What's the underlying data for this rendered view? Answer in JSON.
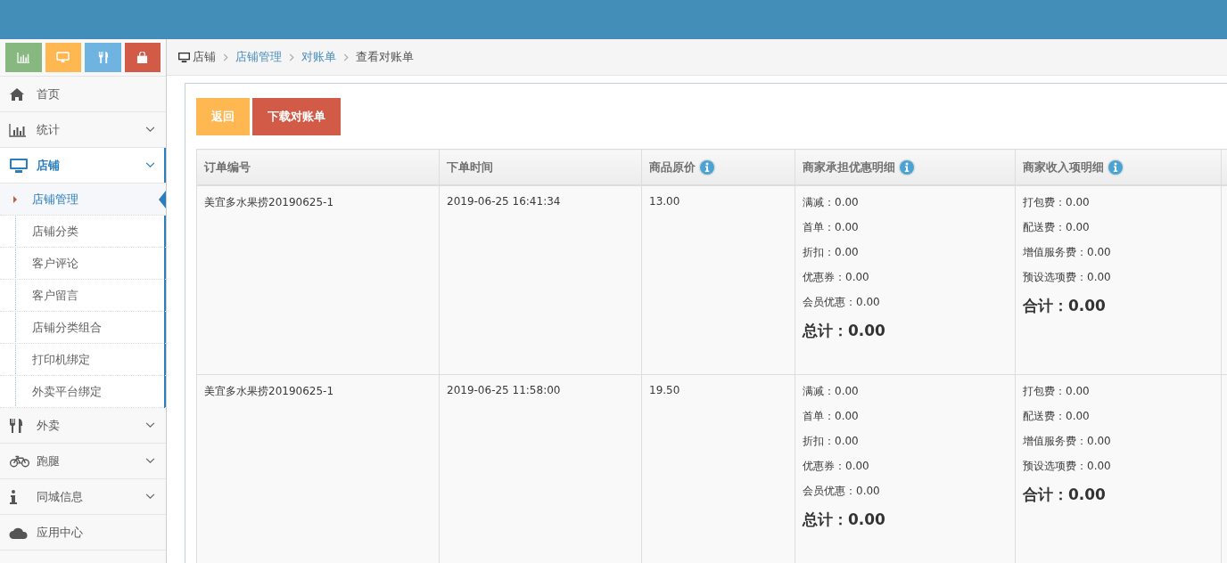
{
  "sidebar": {
    "shortcuts": [
      {
        "kind": "chart",
        "color": "#87b87f"
      },
      {
        "kind": "monitor",
        "color": "#ffb752"
      },
      {
        "kind": "utensils",
        "color": "#6fb3e0"
      },
      {
        "kind": "bag",
        "color": "#d15b47"
      }
    ],
    "menu": [
      {
        "label": "首页",
        "kind": "home",
        "has_children": false,
        "expanded": false,
        "selected": false
      },
      {
        "label": "统计",
        "kind": "chart",
        "has_children": true,
        "expanded": false,
        "selected": false
      },
      {
        "label": "店铺",
        "kind": "monitor",
        "has_children": true,
        "expanded": true,
        "selected": true,
        "children": [
          {
            "label": "店铺管理",
            "selected": true
          },
          {
            "label": "店铺分类",
            "selected": false
          },
          {
            "label": "客户评论",
            "selected": false
          },
          {
            "label": "客户留言",
            "selected": false
          },
          {
            "label": "店铺分类组合",
            "selected": false
          },
          {
            "label": "打印机绑定",
            "selected": false
          },
          {
            "label": "外卖平台绑定",
            "selected": false
          }
        ]
      },
      {
        "label": "外卖",
        "kind": "utensils",
        "has_children": true,
        "expanded": false,
        "selected": false
      },
      {
        "label": "跑腿",
        "kind": "bicycle",
        "has_children": true,
        "expanded": false,
        "selected": false
      },
      {
        "label": "同城信息",
        "kind": "info",
        "has_children": true,
        "expanded": false,
        "selected": false
      },
      {
        "label": "应用中心",
        "kind": "cloud",
        "has_children": false,
        "expanded": false,
        "selected": false
      }
    ]
  },
  "breadcrumb": [
    {
      "label": "店铺",
      "kind": "home"
    },
    {
      "label": "店铺管理",
      "kind": "link"
    },
    {
      "label": "对账单",
      "kind": "link"
    },
    {
      "label": "查看对账单",
      "kind": "current"
    }
  ],
  "buttons": [
    {
      "label": "返回",
      "color": "#ffb752"
    },
    {
      "label": "下载对账单",
      "color": "#d15b47"
    }
  ],
  "table": {
    "columns": [
      {
        "label": "订单编号",
        "info": false
      },
      {
        "label": "下单时间",
        "info": false
      },
      {
        "label": "商品原价",
        "info": true
      },
      {
        "label": "商家承担优惠明细",
        "info": true
      },
      {
        "label": "商家收入项明细",
        "info": true
      }
    ],
    "rows": [
      {
        "order_no": "美宜多水果捞20190625-1",
        "time": "2019-06-25 16:41:34",
        "price": "13.00",
        "discounts": [
          "满减：0.00",
          "首单：0.00",
          "折扣：0.00",
          "优惠券：0.00",
          "会员优惠：0.00"
        ],
        "discount_total": "总计：0.00",
        "income": [
          "打包费：0.00",
          "配送费：0.00",
          "增值服务费：0.00",
          "预设选项费：0.00"
        ],
        "income_total": "合计：0.00"
      },
      {
        "order_no": "美宜多水果捞20190625-1",
        "time": "2019-06-25 11:58:00",
        "price": "19.50",
        "discounts": [
          "满减：0.00",
          "首单：0.00",
          "折扣：0.00",
          "优惠券：0.00",
          "会员优惠：0.00"
        ],
        "discount_total": "总计：0.00",
        "income": [
          "打包费：0.00",
          "配送费：0.00",
          "增值服务费：0.00",
          "预设选项费：0.00"
        ],
        "income_total": "合计：0.00"
      }
    ]
  }
}
